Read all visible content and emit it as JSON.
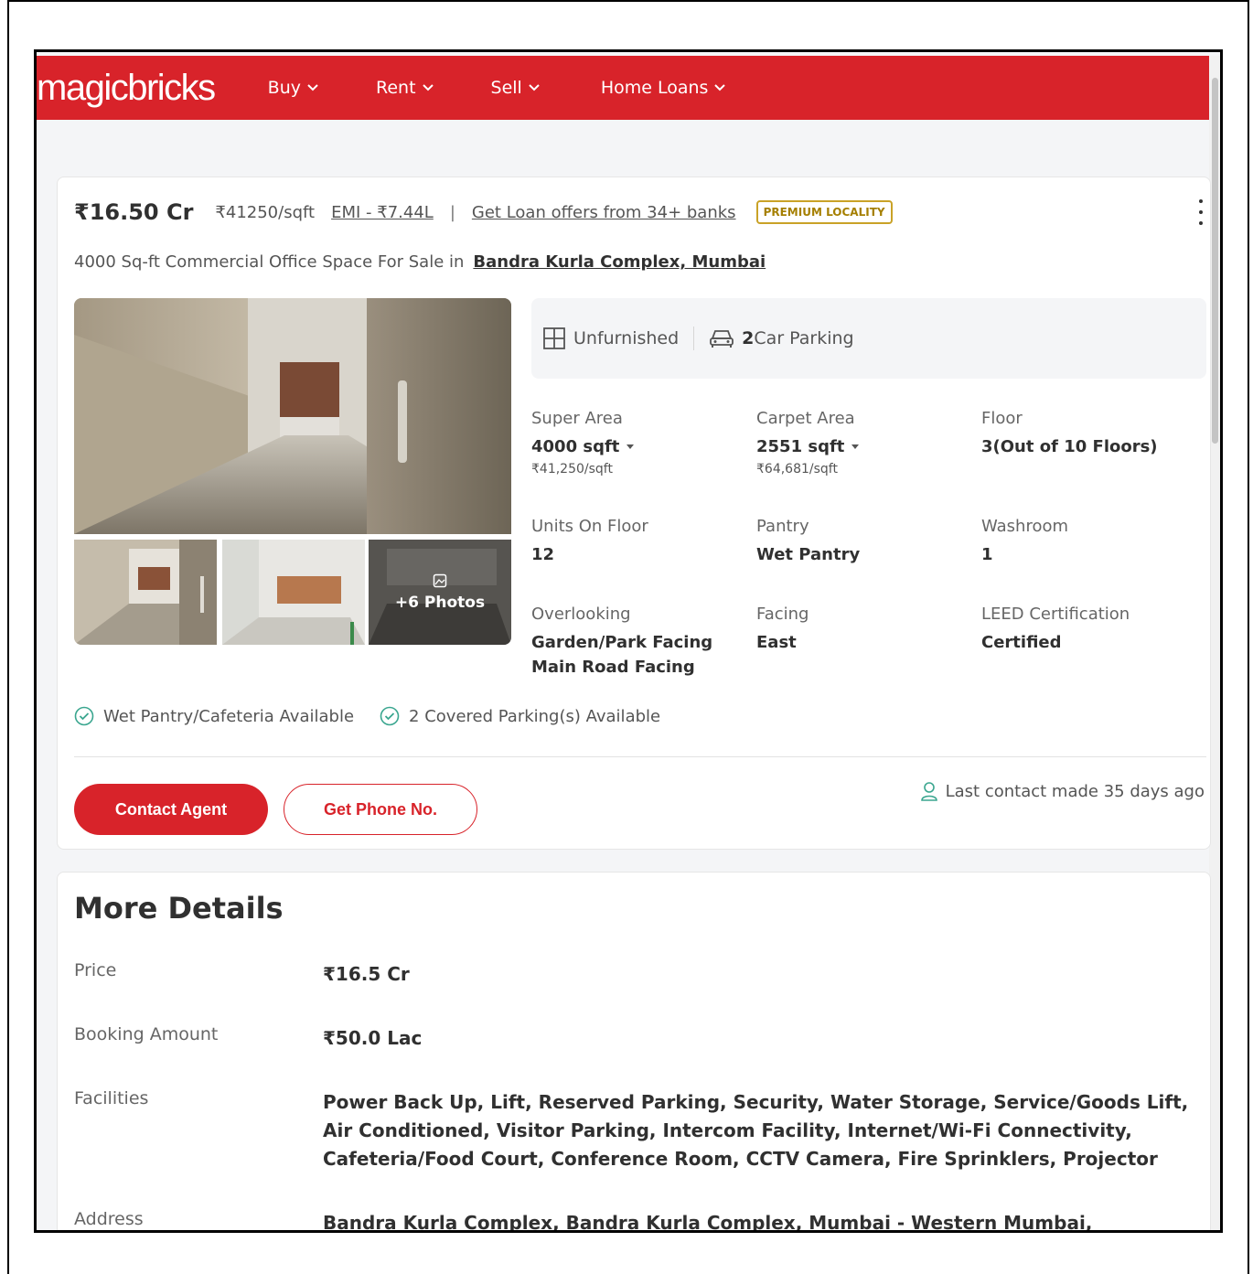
{
  "header": {
    "logo": "magicbricks",
    "nav": [
      {
        "label": "Buy"
      },
      {
        "label": "Rent"
      },
      {
        "label": "Sell"
      },
      {
        "label": "Home Loans"
      }
    ],
    "brand_color": "#d8232a"
  },
  "listing": {
    "price": "₹16.50 Cr",
    "price_per_sqft": "₹41250/sqft",
    "emi": "EMI - ₹7.44L",
    "separator": "|",
    "loan_offers": "Get Loan offers from 34+ banks",
    "badge": "PREMIUM LOCALITY",
    "subtitle_prefix": "4000 Sq-ft Commercial Office Space For Sale in",
    "location": "Bandra Kurla Complex, Mumbai",
    "more_photos": "+6 Photos",
    "tags": {
      "furnishing": "Unfurnished",
      "parking_count": "2",
      "parking_label": "Car Parking"
    },
    "specs": {
      "super_area": {
        "label": "Super Area",
        "value": "4000 sqft",
        "sub": "₹41,250/sqft"
      },
      "carpet_area": {
        "label": "Carpet Area",
        "value": "2551 sqft",
        "sub": "₹64,681/sqft"
      },
      "floor": {
        "label": "Floor",
        "value": "3(Out of 10 Floors)"
      },
      "units": {
        "label": "Units On Floor",
        "value": "12"
      },
      "pantry": {
        "label": "Pantry",
        "value": "Wet Pantry"
      },
      "washroom": {
        "label": "Washroom",
        "value": "1"
      },
      "overlooking": {
        "label": "Overlooking",
        "value1": "Garden/Park Facing",
        "value2": "Main Road Facing"
      },
      "facing": {
        "label": "Facing",
        "value": "East"
      },
      "leed": {
        "label": "LEED Certification",
        "value": "Certified"
      }
    },
    "availability": [
      "Wet Pantry/Cafeteria Available",
      "2 Covered Parking(s) Available"
    ],
    "contact_agent": "Contact Agent",
    "get_phone": "Get Phone No.",
    "last_contact": "Last contact made 35 days ago"
  },
  "more_details": {
    "title": "More Details",
    "rows": [
      {
        "label": "Price",
        "value": "₹16.5 Cr"
      },
      {
        "label": "Booking Amount",
        "value": "₹50.0 Lac"
      },
      {
        "label": "Facilities",
        "value": "Power Back Up, Lift, Reserved Parking, Security, Water Storage, Service/Goods Lift, Air Conditioned, Visitor Parking, Intercom Facility, Internet/Wi-Fi Connectivity, Cafeteria/Food Court, Conference Room, CCTV Camera, Fire Sprinklers, Projector"
      },
      {
        "label": "Address",
        "value": "Bandra Kurla Complex, Bandra Kurla Complex, Mumbai - Western Mumbai,"
      }
    ]
  }
}
